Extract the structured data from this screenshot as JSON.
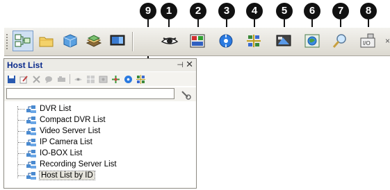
{
  "callouts": [
    "1",
    "2",
    "3",
    "4",
    "5",
    "6",
    "7",
    "8",
    "9"
  ],
  "toolbar": {
    "buttons": [
      {
        "icon": "site-list-icon"
      },
      {
        "icon": "folder-icon"
      },
      {
        "icon": "cube-icon"
      },
      {
        "icon": "stack-icon"
      },
      {
        "icon": "monitor-icon"
      },
      {
        "icon": "eye-icon"
      },
      {
        "icon": "panel-icon"
      },
      {
        "icon": "blue-disc-icon"
      },
      {
        "icon": "network-icon"
      },
      {
        "icon": "display-icon"
      },
      {
        "icon": "globe-icon"
      },
      {
        "icon": "magnifier-icon"
      },
      {
        "icon": "io-device-icon"
      }
    ],
    "close_glyph": "×",
    "io_badge": "I/O"
  },
  "panel": {
    "title": "Host List",
    "pin_glyph": "⊣",
    "close_glyph": "✕",
    "search": {
      "value": "",
      "placeholder": ""
    },
    "items": [
      {
        "label": "DVR List"
      },
      {
        "label": "Compact DVR List"
      },
      {
        "label": "Video Server List"
      },
      {
        "label": "IP Camera List"
      },
      {
        "label": "IO-BOX List"
      },
      {
        "label": "Recording Server List"
      },
      {
        "label": "Host List by ID"
      }
    ],
    "selected_index": 6
  },
  "colors": {
    "callout": "#111111",
    "title_text": "#0a2a8c",
    "toolbar_bg": "#dcd9d0"
  }
}
